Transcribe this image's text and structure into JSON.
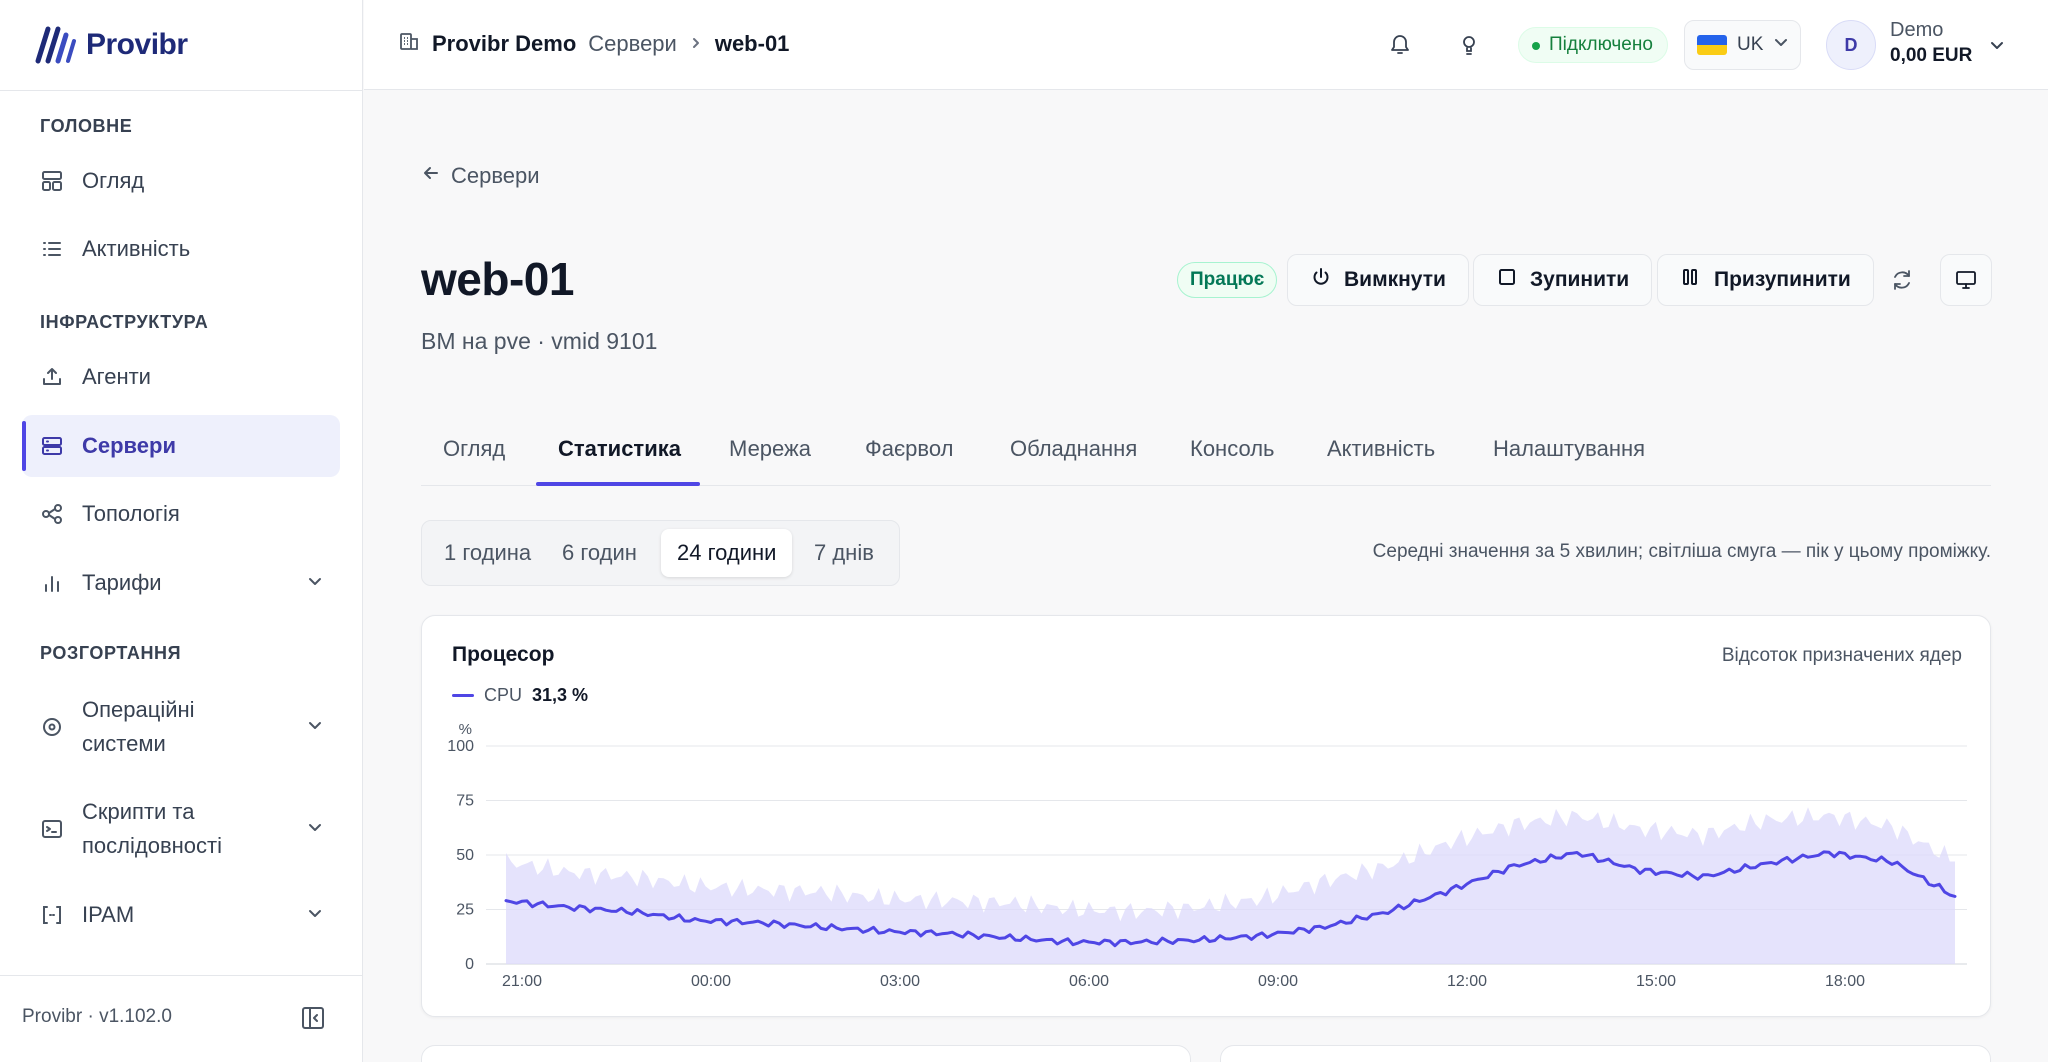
{
  "app": {
    "name": "Provibr",
    "version": "Provibr · v1.102.0"
  },
  "sidebar": {
    "sections": [
      {
        "label": "ГОЛОВНЕ"
      },
      {
        "label": "ІНФРАСТРУКТУРА"
      },
      {
        "label": "РОЗГОРТАННЯ"
      }
    ],
    "items": [
      {
        "label": "Огляд",
        "icon": "dashboard-icon"
      },
      {
        "label": "Активність",
        "icon": "list-icon"
      },
      {
        "label": "Агенти",
        "icon": "upload-tray-icon"
      },
      {
        "label": "Сервери",
        "icon": "server-icon",
        "active": true
      },
      {
        "label": "Топологія",
        "icon": "share-nodes-icon"
      },
      {
        "label": "Тарифи",
        "icon": "bar-chart-icon",
        "expandable": true
      },
      {
        "label_line1": "Операційні",
        "label_line2": "системи",
        "icon": "disc-icon",
        "expandable": true
      },
      {
        "label_line1": "Скрипти та",
        "label_line2": "послідовності",
        "icon": "terminal-icon",
        "expandable": true
      },
      {
        "label": "IPAM",
        "icon": "brackets-icon",
        "expandable": true
      }
    ]
  },
  "header": {
    "org": "Provibr Demo",
    "breadcrumb_servers": "Сервери",
    "breadcrumb_current": "web-01",
    "connection_status": "Підключено",
    "language": "UK",
    "user": {
      "initial": "D",
      "name": "Demo",
      "balance": "0,00 EUR"
    }
  },
  "page": {
    "back_label": "Сервери",
    "title": "web-01",
    "subtitle": "ВМ на pve · vmid 9101",
    "status": "Працює",
    "actions": {
      "power_off": "Вимкнути",
      "stop": "Зупинити",
      "pause": "Призупинити"
    }
  },
  "tabs": [
    {
      "label": "Огляд"
    },
    {
      "label": "Статистика",
      "active": true
    },
    {
      "label": "Мережа"
    },
    {
      "label": "Фаєрвол"
    },
    {
      "label": "Обладнання"
    },
    {
      "label": "Консоль"
    },
    {
      "label": "Активність"
    },
    {
      "label": "Налаштування"
    }
  ],
  "range": {
    "options": [
      "1 година",
      "6 годин",
      "24 години",
      "7 днів"
    ],
    "selected": "24 години",
    "note": "Середні значення за 5 хвилин; світліша смуга — пік у цьому проміжку."
  },
  "cpu_card": {
    "title": "Процесор",
    "caption": "Відсоток призначених ядер",
    "legend_label": "CPU",
    "legend_value": "31,3 %"
  },
  "colors": {
    "accent": "#4f46e5",
    "band": "#dcd9fb",
    "success": "#16a34a"
  },
  "chart_data": {
    "type": "line",
    "ylabel": "%",
    "ylim": [
      0,
      100
    ],
    "yticks": [
      0,
      25,
      50,
      75,
      100
    ],
    "xlim": [
      "21:00",
      "20:00"
    ],
    "xticks": [
      "21:00",
      "00:00",
      "03:00",
      "06:00",
      "09:00",
      "12:00",
      "15:00",
      "18:00"
    ],
    "grid": true,
    "legend": "top-left",
    "series": [
      {
        "name": "CPU",
        "description": "average (line), hourly approx",
        "x": [
          "21:00",
          "22:00",
          "23:00",
          "00:00",
          "01:00",
          "02:00",
          "03:00",
          "04:00",
          "05:00",
          "06:00",
          "07:00",
          "08:00",
          "09:00",
          "10:00",
          "11:00",
          "12:00",
          "13:00",
          "14:00",
          "15:00",
          "16:00",
          "17:00",
          "18:00",
          "19:00",
          "20:00"
        ],
        "values": [
          29,
          26,
          24,
          20,
          19,
          17,
          15,
          14,
          12,
          10,
          10,
          11,
          13,
          17,
          24,
          34,
          45,
          51,
          43,
          40,
          46,
          51,
          47,
          31
        ]
      },
      {
        "name": "peak",
        "description": "5-min peak band upper bound, hourly approx",
        "x": [
          "21:00",
          "22:00",
          "23:00",
          "00:00",
          "01:00",
          "02:00",
          "03:00",
          "04:00",
          "05:00",
          "06:00",
          "07:00",
          "08:00",
          "09:00",
          "10:00",
          "11:00",
          "12:00",
          "13:00",
          "14:00",
          "15:00",
          "16:00",
          "17:00",
          "18:00",
          "19:00",
          "20:00"
        ],
        "values": [
          47,
          42,
          40,
          36,
          34,
          33,
          30,
          29,
          28,
          25,
          24,
          26,
          30,
          38,
          45,
          56,
          64,
          68,
          62,
          59,
          66,
          68,
          63,
          47
        ]
      }
    ]
  }
}
